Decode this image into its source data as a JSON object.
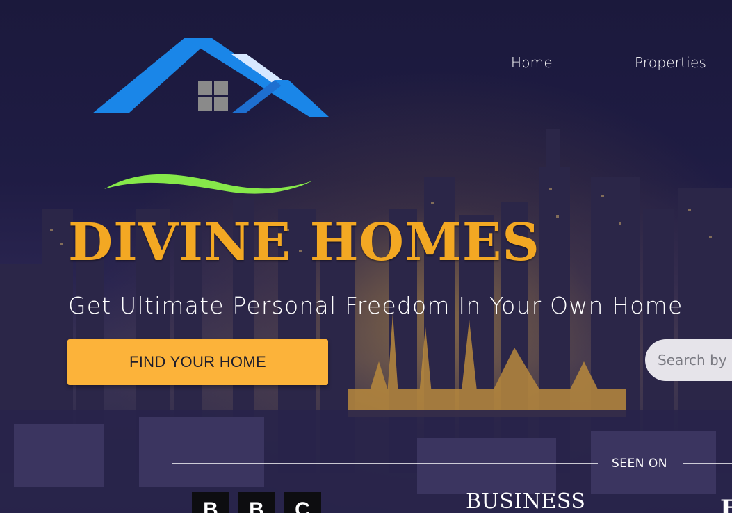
{
  "nav": {
    "items": [
      {
        "label": "Home"
      },
      {
        "label": "Properties"
      }
    ]
  },
  "hero": {
    "brand": "DIVINE HOMES",
    "tagline": "Get Ultimate Personal Freedom In Your Own Home",
    "cta_label": "FIND YOUR HOME",
    "search_placeholder": "Search by"
  },
  "seen_on": {
    "label": "SEEN ON",
    "logos": {
      "bbc": [
        "B",
        "B",
        "C"
      ],
      "business": "BUSINESS",
      "partial": "F"
    }
  },
  "colors": {
    "brand": "#f3a823",
    "button": "#fcb33a",
    "roof_blue": "#1a86e8",
    "swoosh_green": "#86e84a",
    "background": "#1c1a3f"
  },
  "icons": [
    "house-roof-logo-icon",
    "window-icon"
  ]
}
